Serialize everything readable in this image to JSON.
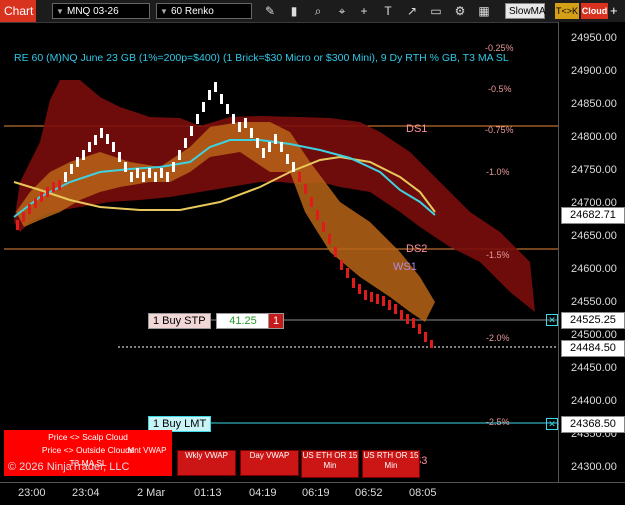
{
  "toolbar": {
    "chart_tab": "Chart",
    "instrument": "MNQ 03-26",
    "bar_type": "60 Renko",
    "icons": [
      "pencil-icon",
      "zoom-icon",
      "crosshair-icon",
      "plus-icon",
      "text-icon",
      "arrow-icon",
      "window-icon",
      "settings-icon",
      "grid-icon"
    ],
    "slowma": "SlowMA",
    "tck": "T<>K",
    "cloud": "Cloud",
    "plus": "+"
  },
  "title": "RE 60 (M)NQ June 23 GB (1%=200p=$400) (1 Brick=$30 Micro or $300 Mini), 9 Dy RTH % GB, T3 MA SL",
  "percent_levels": [
    "-0.25%",
    "-0.5%",
    "-0.75%",
    "-1.0%",
    "-1.5%",
    "-2.0%",
    "-2.5%"
  ],
  "levels": {
    "ds1": "DS1",
    "ds2": "DS2",
    "ws1": "WS1",
    "ds3": "DS3"
  },
  "price_axis": {
    "ticks": [
      "24950.00",
      "24900.00",
      "24850.00",
      "24800.00",
      "24750.00",
      "24700.00",
      "24650.00",
      "24600.00",
      "24550.00",
      "24500.00",
      "24450.00",
      "24400.00",
      "24350.00",
      "24300.00"
    ],
    "last_price": "24682.71",
    "stop_price": "24525.25",
    "current_price": "24484.50",
    "limit_price": "24368.50"
  },
  "time_axis": [
    "23:00",
    "23:04",
    "2 Mar",
    "01:13",
    "04:19",
    "06:19",
    "06:52",
    "08:05"
  ],
  "orders": {
    "stop_label": "1 Buy STP",
    "stop_value": "41.25",
    "stop_qty": "1",
    "limit_label": "1 Buy LMT"
  },
  "cloud_panel": {
    "line1": "Price <> Scalp Cloud",
    "line2": "Price <> Outside Clouds",
    "line3": "T3 MA SL"
  },
  "buttons": {
    "mnt_vwap": "Mnt VWAP",
    "wkly_vwap": "Wkly VWAP",
    "day_vwap": "Day VWAP",
    "us_eth_or": "US ETH OR 15 Min",
    "us_rth_or": "US RTH OR 15 Min"
  },
  "copyright": "© 2026 NinjaTrader, LLC",
  "colors": {
    "cloud_red": "#8b0a0a",
    "cloud_orange": "#c9701c",
    "fast_ma": "#3fd1e0",
    "slow_ma": "#e8c85a",
    "level_orange": "#e88a3a",
    "up_brick": "#ffffff",
    "down_brick": "#e01b1b"
  }
}
